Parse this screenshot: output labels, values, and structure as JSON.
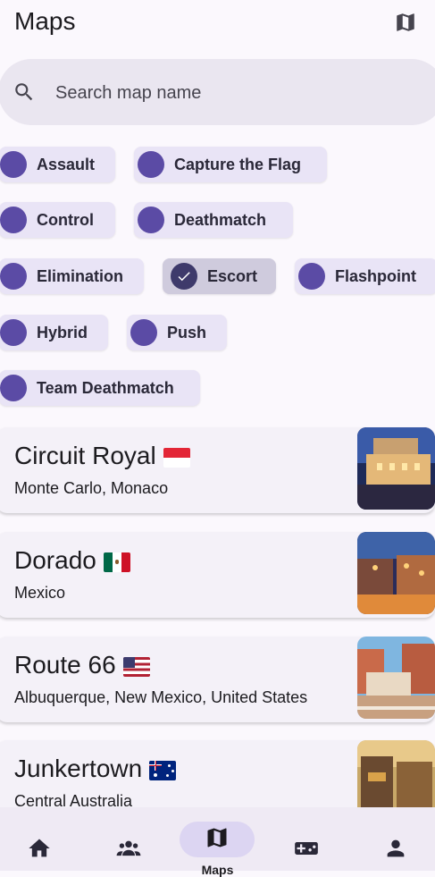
{
  "header": {
    "title": "Maps",
    "map_icon": "map-icon"
  },
  "search": {
    "placeholder": "Search map name",
    "value": "",
    "icon": "search-icon"
  },
  "filters": [
    {
      "label": "Assault",
      "selected": false
    },
    {
      "label": "Capture the Flag",
      "selected": false
    },
    {
      "label": "Control",
      "selected": false
    },
    {
      "label": "Deathmatch",
      "selected": false
    },
    {
      "label": "Elimination",
      "selected": false
    },
    {
      "label": "Escort",
      "selected": true
    },
    {
      "label": "Flashpoint",
      "selected": false
    },
    {
      "label": "Hybrid",
      "selected": false
    },
    {
      "label": "Push",
      "selected": false
    },
    {
      "label": "Team Deathmatch",
      "selected": false
    }
  ],
  "maps": [
    {
      "name": "Circuit Royal",
      "location": "Monte Carlo, Monaco",
      "flag": "monaco"
    },
    {
      "name": "Dorado",
      "location": "Mexico",
      "flag": "mexico"
    },
    {
      "name": "Route 66",
      "location": "Albuquerque, New Mexico, United States",
      "flag": "usa"
    },
    {
      "name": "Junkertown",
      "location": "Central Australia",
      "flag": "australia"
    }
  ],
  "nav": {
    "items": [
      {
        "icon": "home-icon"
      },
      {
        "icon": "people-icon"
      },
      {
        "icon": "map-icon",
        "label": "Maps",
        "active": true
      },
      {
        "icon": "gamepad-icon"
      },
      {
        "icon": "person-icon"
      }
    ]
  },
  "colors": {
    "accent": "#5B4BA5",
    "chip_bg": "#E9E4F6",
    "chip_selected_bg": "#CFCBDD",
    "nav_bg": "#EFEAF4"
  }
}
